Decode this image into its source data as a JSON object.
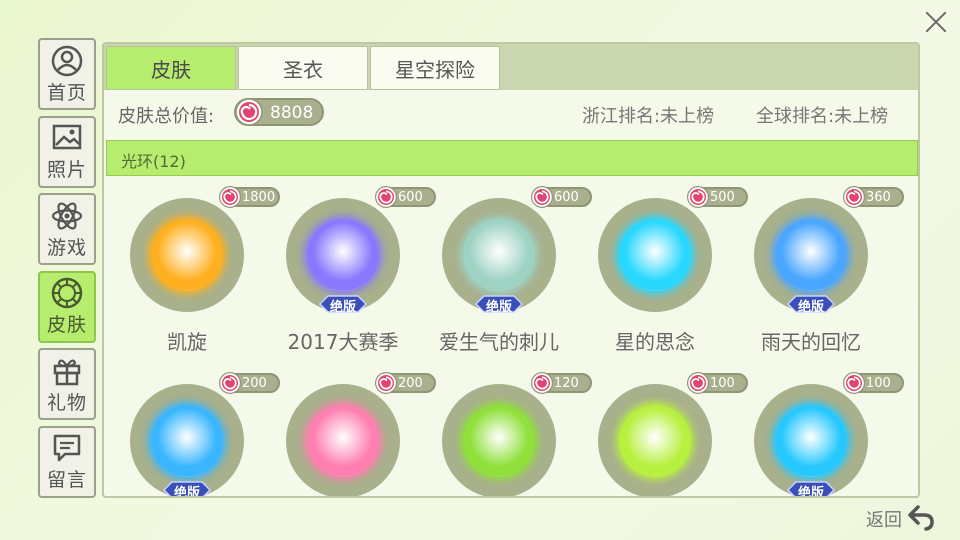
{
  "nav": {
    "items": [
      {
        "label": "首页",
        "icon": "user-icon"
      },
      {
        "label": "照片",
        "icon": "photo-icon"
      },
      {
        "label": "游戏",
        "icon": "atom-icon"
      },
      {
        "label": "皮肤",
        "icon": "skin-icon",
        "active": true
      },
      {
        "label": "礼物",
        "icon": "gift-icon"
      },
      {
        "label": "留言",
        "icon": "message-icon"
      }
    ]
  },
  "tabs": [
    {
      "label": "皮肤",
      "active": true
    },
    {
      "label": "圣衣"
    },
    {
      "label": "星空探险"
    }
  ],
  "summary": {
    "total_label": "皮肤总价值:",
    "total_value": "8808",
    "province_rank": "浙江排名:未上榜",
    "global_rank": "全球排名:未上榜"
  },
  "section": {
    "title": "光环(12)"
  },
  "skins": [
    {
      "name": "凯旋",
      "price": "1800",
      "badge": "",
      "color": "#ffb020"
    },
    {
      "name": "2017大赛季",
      "price": "600",
      "badge": "绝版",
      "color": "#8a78ff"
    },
    {
      "name": "爱生气的刺儿",
      "price": "600",
      "badge": "绝版",
      "color": "#9ed3c4"
    },
    {
      "name": "星的思念",
      "price": "500",
      "badge": "",
      "color": "#29d8ff"
    },
    {
      "name": "雨天的回忆",
      "price": "360",
      "badge": "绝版",
      "color": "#4aa6ff"
    },
    {
      "name": "",
      "price": "200",
      "badge": "绝版",
      "color": "#39b6ff"
    },
    {
      "name": "",
      "price": "200",
      "badge": "",
      "color": "#ff7fb0"
    },
    {
      "name": "",
      "price": "120",
      "badge": "",
      "color": "#8fe03a"
    },
    {
      "name": "",
      "price": "100",
      "badge": "",
      "color": "#b8f040"
    },
    {
      "name": "",
      "price": "100",
      "badge": "绝版",
      "color": "#27c8ff"
    }
  ],
  "back": {
    "label": "返回"
  }
}
